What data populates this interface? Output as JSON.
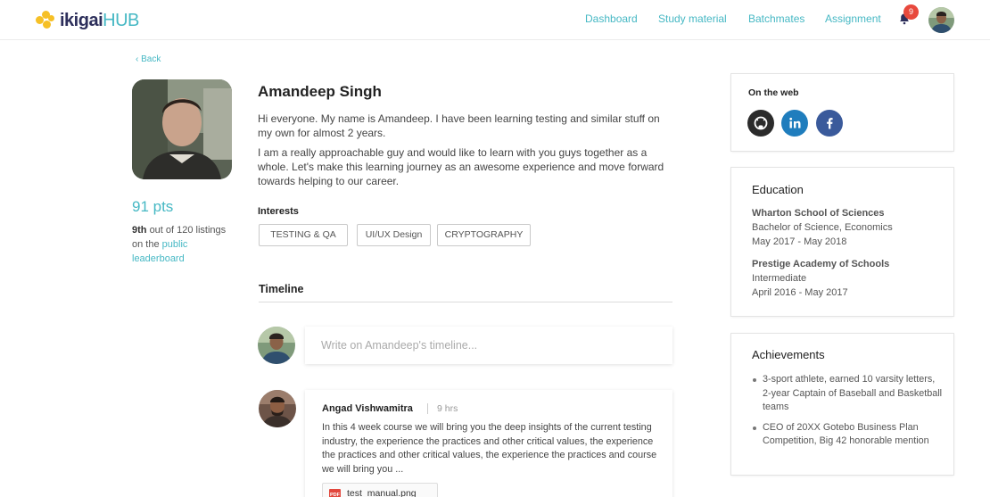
{
  "brand": {
    "name_part1": "ikigai",
    "name_part2": "HUB",
    "logo_color": "#f6c026",
    "accent": "#46b8c4"
  },
  "nav": {
    "items": [
      "Dashboard",
      "Study material",
      "Batchmates",
      "Assignment"
    ],
    "notification_count": "9",
    "bell_icon": "bell-icon"
  },
  "profile": {
    "back_label": "Back",
    "name": "Amandeep Singh",
    "bio": [
      "Hi everyone. My name is Amandeep. I have been learning testing and similar stuff on my own for almost 2 years.",
      "I am a really approachable guy and would like to learn with you guys together as a whole. Let's make this learning journey as an awesome experience and move forward towards helping to our career."
    ],
    "points": "91 pts",
    "rank": "9th",
    "rank_text": "out of 120 listings on the",
    "leaderboard_link": "public leaderboard",
    "interests_title": "Interests",
    "interests": [
      "TESTING & QA",
      "UI/UX Design",
      "CRYPTOGRAPHY"
    ]
  },
  "timeline": {
    "title": "Timeline",
    "composer_placeholder": "Write on Amandeep's timeline...",
    "posts": [
      {
        "author": "Angad Vishwamitra",
        "time": "9 hrs",
        "body": "In this 4 week course we will bring you the deep insights of the current testing industry, the experience the practices and other critical values, the experience the practices and other critical values, the experience the practices and course we will bring you ...",
        "attachment": "test_manual.png",
        "attachment_icon": "pdf-icon",
        "attachment_icon_label": "PDF"
      }
    ]
  },
  "sidebar": {
    "web_title": "On the web",
    "socials": [
      {
        "name": "github-icon",
        "color": "#2b2b2b"
      },
      {
        "name": "linkedin-icon",
        "color": "#1f7dbd"
      },
      {
        "name": "facebook-icon",
        "color": "#3a5a9b"
      }
    ],
    "education_title": "Education",
    "education": [
      {
        "school": "Wharton School of Sciences",
        "degree": "Bachelor of Science, Economics",
        "dates": "May 2017 - May 2018"
      },
      {
        "school": "Prestige Academy of Schools",
        "degree": "Intermediate",
        "dates": "April 2016 - May 2017"
      }
    ],
    "achievements_title": "Achievements",
    "achievements": [
      "3-sport athlete, earned 10 varsity letters, 2-year Captain of Baseball and Basketball teams",
      "CEO of 20XX Gotebo Business Plan Competition, Big 42 honorable mention"
    ]
  }
}
